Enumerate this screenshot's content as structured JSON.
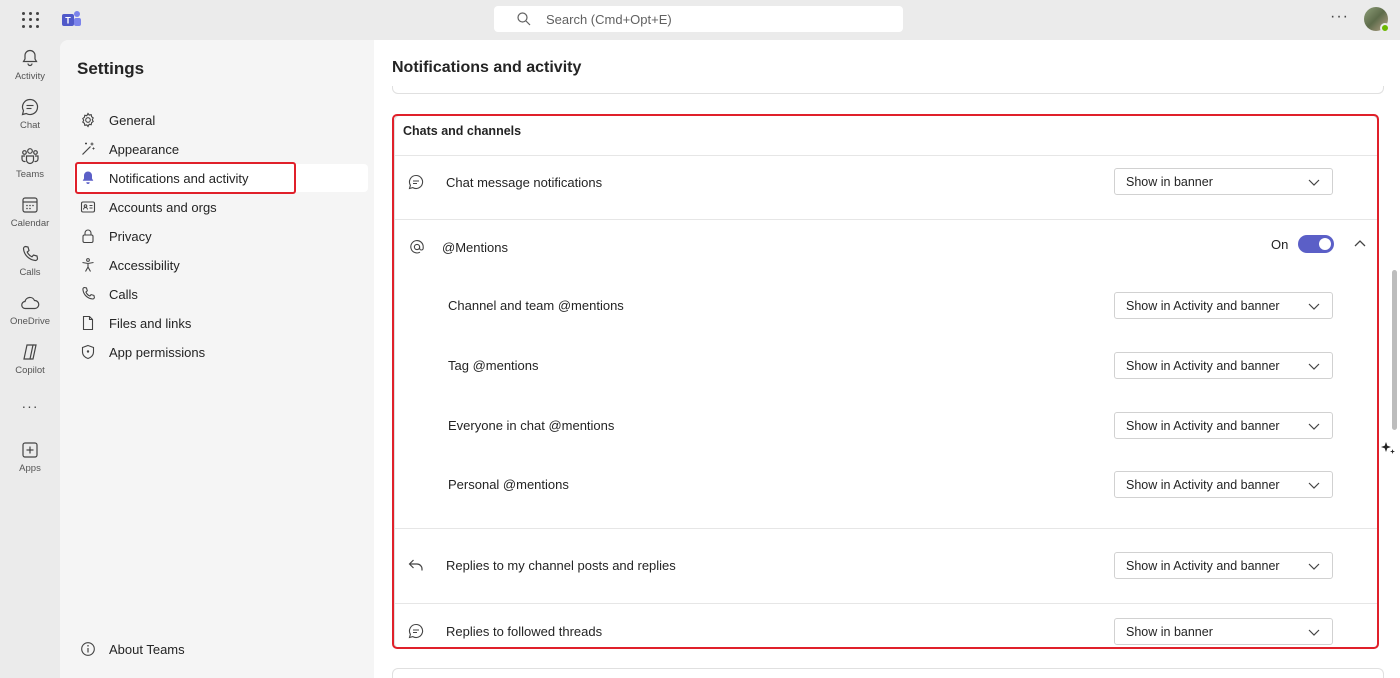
{
  "search": {
    "placeholder": "Search (Cmd+Opt+E)"
  },
  "rail": {
    "items": [
      {
        "label": "Activity",
        "icon": "bell-icon"
      },
      {
        "label": "Chat",
        "icon": "chat-icon"
      },
      {
        "label": "Teams",
        "icon": "teams-icon"
      },
      {
        "label": "Calendar",
        "icon": "calendar-icon"
      },
      {
        "label": "Calls",
        "icon": "phone-icon"
      },
      {
        "label": "OneDrive",
        "icon": "cloud-icon"
      },
      {
        "label": "Copilot",
        "icon": "copilot-icon"
      },
      {
        "label": "Apps",
        "icon": "plus-square-icon"
      }
    ]
  },
  "sidebar": {
    "title": "Settings",
    "items": [
      {
        "label": "General",
        "icon": "gear-icon"
      },
      {
        "label": "Appearance",
        "icon": "wand-icon"
      },
      {
        "label": "Notifications and activity",
        "icon": "bell-icon",
        "active": true
      },
      {
        "label": "Accounts and orgs",
        "icon": "id-card-icon"
      },
      {
        "label": "Privacy",
        "icon": "lock-icon"
      },
      {
        "label": "Accessibility",
        "icon": "accessibility-icon"
      },
      {
        "label": "Calls",
        "icon": "phone-icon"
      },
      {
        "label": "Files and links",
        "icon": "file-icon"
      },
      {
        "label": "App permissions",
        "icon": "shield-icon"
      }
    ],
    "about": "About Teams"
  },
  "main": {
    "title": "Notifications and activity",
    "section": {
      "title": "Chats and channels",
      "chat_message": {
        "label": "Chat message notifications",
        "value": "Show in banner"
      },
      "mentions": {
        "label": "@Mentions",
        "toggle_label": "On",
        "toggle_on": true,
        "items": [
          {
            "label": "Channel and team @mentions",
            "value": "Show in Activity and banner"
          },
          {
            "label": "Tag @mentions",
            "value": "Show in Activity and banner"
          },
          {
            "label": "Everyone in chat @mentions",
            "value": "Show in Activity and banner"
          },
          {
            "label": "Personal @mentions",
            "value": "Show in Activity and banner"
          }
        ]
      },
      "replies_posts": {
        "label": "Replies to my channel posts and replies",
        "value": "Show in Activity and banner"
      },
      "replies_threads": {
        "label": "Replies to followed threads",
        "value": "Show in banner"
      }
    }
  },
  "colors": {
    "accent": "#5b5fc7",
    "highlight": "#e0202a"
  }
}
